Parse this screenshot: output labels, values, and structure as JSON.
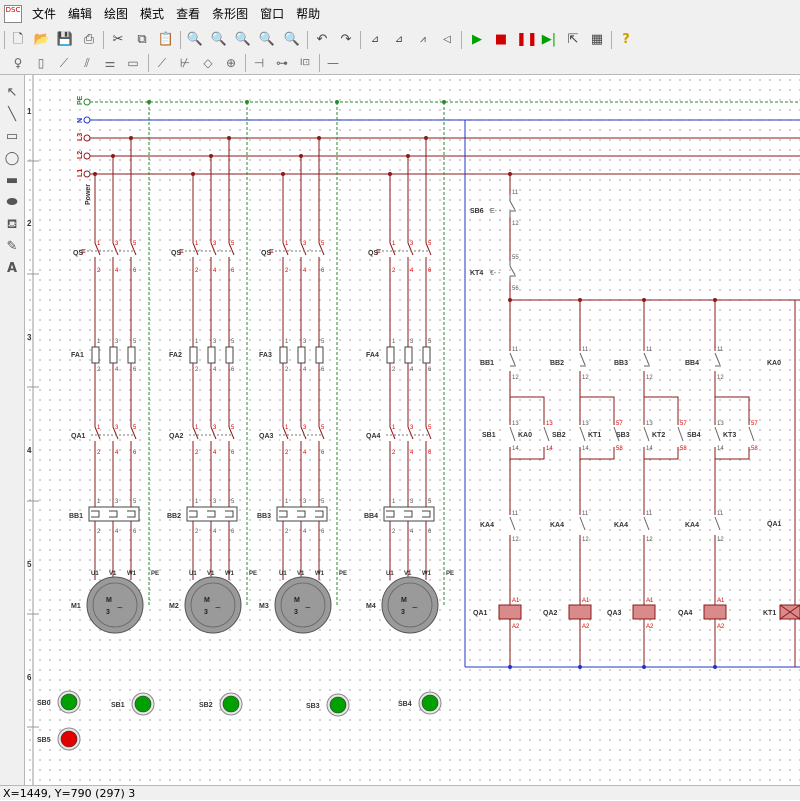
{
  "menubar": {
    "app_icon_text": "DSC",
    "items": [
      "文件",
      "编辑",
      "绘图",
      "模式",
      "查看",
      "条形图",
      "窗口",
      "帮助"
    ]
  },
  "toolbar1": {
    "icons": [
      "new-file-icon",
      "open-folder-icon",
      "save-icon",
      "print-icon",
      "cut-icon",
      "copy-icon",
      "paste-icon",
      "zoom-in-icon",
      "zoom-out-icon",
      "zoom-fit-icon",
      "zoom-window-icon",
      "zoom-pan-icon",
      "undo-icon",
      "redo-icon",
      "align-left-icon",
      "align-center-icon",
      "flip-h-icon",
      "flip-v-icon",
      "run-icon",
      "stop-icon",
      "pause-icon",
      "step-icon",
      "export-icon",
      "print-preview-icon",
      "help-icon"
    ]
  },
  "left_tools": [
    "pointer-tool-icon",
    "line-tool-icon",
    "rectangle-tool-icon",
    "ellipse-tool-icon",
    "filled-rectangle-tool-icon",
    "filled-ellipse-tool-icon",
    "fill-tool-icon",
    "pen-tool-icon",
    "text-tool-icon"
  ],
  "rulers": {
    "rows": [
      "1",
      "2",
      "3",
      "4",
      "5",
      "6"
    ]
  },
  "bus": {
    "labels": [
      "PE",
      "N",
      "L3",
      "L2",
      "L1"
    ],
    "power_label": "Power"
  },
  "motor_circuits": [
    {
      "breaker": "QS",
      "fuse": "FA1",
      "contactor": "QA1",
      "overload": "BB1",
      "motor": "M1"
    },
    {
      "breaker": "QS",
      "fuse": "FA2",
      "contactor": "QA2",
      "overload": "BB2",
      "motor": "M2"
    },
    {
      "breaker": "QS",
      "fuse": "FA3",
      "contactor": "QA3",
      "overload": "BB3",
      "motor": "M3"
    },
    {
      "breaker": "QS",
      "fuse": "FA4",
      "contactor": "QA4",
      "overload": "BB4",
      "motor": "M4"
    }
  ],
  "terminals": {
    "pole_top": [
      "1",
      "3",
      "5"
    ],
    "pole_bottom": [
      "2",
      "4",
      "6"
    ],
    "motor": [
      "U1",
      "V1",
      "W1",
      "PE"
    ],
    "motor_inner": [
      "M",
      "3",
      "~"
    ]
  },
  "control": {
    "sb6": {
      "label": "SB6",
      "top": "11",
      "bottom": "12"
    },
    "kt4": {
      "label": "KT4",
      "top": "55",
      "bottom": "56"
    },
    "columns": [
      {
        "bb": "BB1",
        "nc_top": "11",
        "nc_bottom": "12",
        "start": "SB1",
        "hold": "KA0",
        "hold_top": "13",
        "hold_bottom": "14",
        "ka": "KA4",
        "coil": "QA1"
      },
      {
        "bb": "BB2",
        "nc_top": "11",
        "nc_bottom": "12",
        "start": "SB2",
        "hold": "KT1",
        "hold_top": "57",
        "hold_bottom": "58",
        "ka": "KA4",
        "coil": "QA2"
      },
      {
        "bb": "BB3",
        "nc_top": "11",
        "nc_bottom": "12",
        "start": "SB3",
        "hold": "KT2",
        "hold_top": "57",
        "hold_bottom": "58",
        "ka": "KA4",
        "coil": "QA3"
      },
      {
        "bb": "BB4",
        "nc_top": "11",
        "nc_bottom": "12",
        "start": "SB4",
        "hold": "KT3",
        "hold_top": "57",
        "hold_bottom": "58",
        "ka": "KA4",
        "coil": "QA4"
      }
    ],
    "inner_terminals": [
      "13",
      "14"
    ],
    "ka_terminals": [
      "11",
      "12"
    ],
    "coil_terminals": [
      "A1",
      "A2"
    ],
    "ka0": "KA0",
    "qa1": "QA1",
    "kt1": "KT1"
  },
  "buttons": [
    {
      "label": "SB0",
      "color": "#00a000"
    },
    {
      "label": "SB1",
      "color": "#00a000"
    },
    {
      "label": "SB2",
      "color": "#00a000"
    },
    {
      "label": "SB3",
      "color": "#00a000"
    },
    {
      "label": "SB4",
      "color": "#00a000"
    },
    {
      "label": "SB5",
      "color": "#e00000"
    }
  ],
  "status": {
    "text": "X=1449, Y=790 (297) 3"
  },
  "colors": {
    "wire": "#8b1a1a",
    "n_line": "#2233cc",
    "pe_line": "#2a8a2a",
    "label_red": "#e00000",
    "coil_fill": "#d98a8a",
    "button_green": "#00a000",
    "button_red": "#e00000"
  }
}
